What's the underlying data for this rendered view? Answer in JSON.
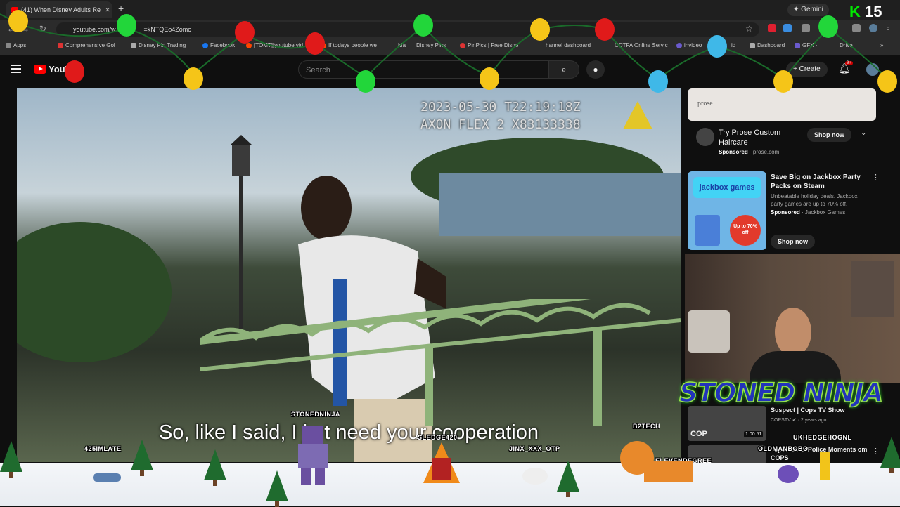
{
  "browser": {
    "tab_title": "(41) When Disney Adults Re",
    "tab_close": "✕",
    "new_tab": "+",
    "gemini_label": "Gemini",
    "url": "youtube.com/w",
    "url_tail": "=kNTQEo4Zomc",
    "bookmarks": [
      "Apps",
      "Comprehensive Gol",
      "Disney Pin Trading",
      "Facebook",
      "[TOMT][youtube vid",
      "If todays people we",
      "Ma",
      "Disney Pins",
      "PinPics | Free Disne",
      "hannel dashboard",
      "CDTFA Online Servic",
      "invideo",
      "id",
      "Dashboard",
      "GFX - ",
      "Drive"
    ]
  },
  "overlay_counter": {
    "k": "K",
    "value": "15"
  },
  "youtube_header": {
    "logo_text": "YouT",
    "search_placeholder": "Search",
    "create_label": "Create",
    "notifications_badge": "9+"
  },
  "video": {
    "timestamp_line1": "2023-05-30 T22:19:18Z",
    "timestamp_line2": "AXON FLEX 2 X83133338",
    "subtitle": "So, like I said, I ju  t need your cooperation"
  },
  "ad_prose": {
    "brand": "prose",
    "title": "Try Prose Custom Haircare",
    "sponsored": "Sponsored",
    "domain": "prose.com",
    "shop_label": "Shop now"
  },
  "ad_jackbox": {
    "logo": "jackbox games",
    "title": "Save Big on Jackbox Party Packs on Steam",
    "description": "Unbeatable holiday deals. Jackbox party games are up to 70% off.",
    "sponsored": "Sponsored",
    "advertiser": "Jackbox Games",
    "shop_label": "Shop now",
    "discount": "Up to 70% off"
  },
  "streamer_overlay": {
    "name": "STONED NINJA"
  },
  "recommended": [
    {
      "title": "Suspect | Cops TV Show",
      "channel": "COPSTV",
      "meta": "· 2 years ago",
      "duration": "1:00:51",
      "thumb_label": "COP"
    },
    {
      "title": "Top 20 Best Police Moments om COPS",
      "channel": "",
      "meta": "",
      "duration": "",
      "thumb_label": ""
    }
  ],
  "chat_names": [
    "STONEDNINJA",
    "425IMLATE",
    "SLEDGE420",
    "JINX_XXX_OTP",
    "B2TECH",
    "ELEVENDEGREE",
    "UKHEDGEHOGNL",
    "OLDMANBOBO"
  ]
}
